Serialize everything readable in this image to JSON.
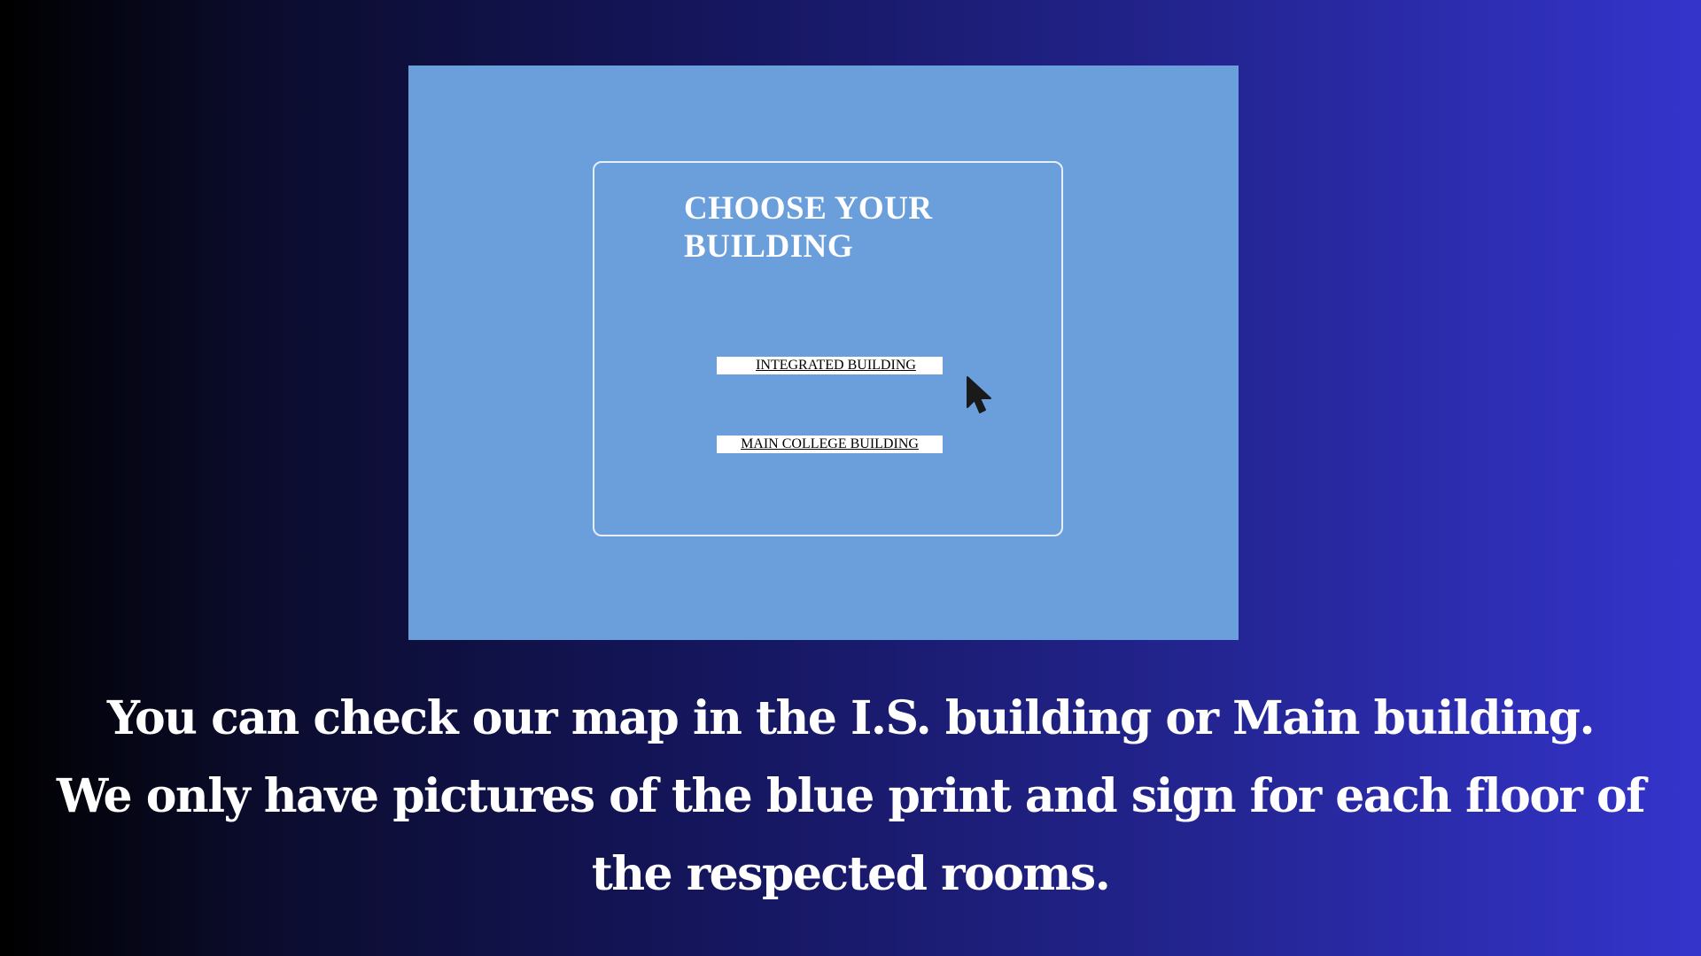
{
  "app": {
    "panel_title": "CHOOSE YOUR\nBUILDING",
    "buttons": [
      {
        "label": "INTEGRATED BUILDING"
      },
      {
        "label": "MAIN COLLEGE BUILDING"
      }
    ],
    "cursor_icon": "arrow-cursor-icon"
  },
  "caption": {
    "lines": [
      "You can check our map in the I.S. building or Main building.",
      "We only have pictures of the blue print and sign for each floor of",
      "the respected rooms."
    ]
  },
  "colors": {
    "app_background": "#6b9fdc",
    "panel_border": "#e6eefb",
    "button_background": "#ffffff",
    "caption_text": "#ffffff",
    "gradient_left": "#000000",
    "gradient_right": "#3434cc"
  }
}
